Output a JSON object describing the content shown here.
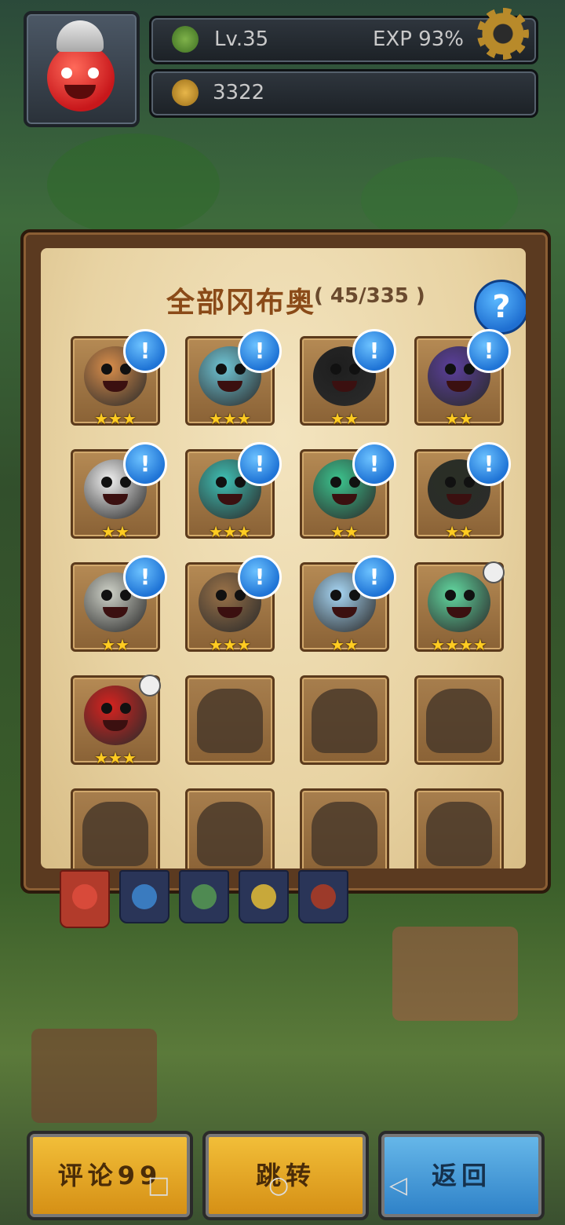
{
  "hud": {
    "level_label": "Lv.35",
    "exp_label": "EXP 93%",
    "gold_value": "3322",
    "icons": {
      "level": "clover-icon",
      "gold": "gold-pouch-icon",
      "settings": "gear-icon"
    }
  },
  "panel": {
    "title": "全部冈布奥",
    "count": "( 45/335 )",
    "help": "?",
    "badge_glyph": "!",
    "cells": [
      {
        "stars": "★★★",
        "badge": true,
        "color": "#d98e4b"
      },
      {
        "stars": "★★★",
        "badge": true,
        "color": "#70c6d6"
      },
      {
        "stars": "★★",
        "badge": true,
        "color": "#1e1e1e"
      },
      {
        "stars": "★★",
        "badge": true,
        "color": "#5b3f9c"
      },
      {
        "stars": "★★",
        "badge": true,
        "color": "#f1f1f1"
      },
      {
        "stars": "★★★",
        "badge": true,
        "color": "#3fc0b4"
      },
      {
        "stars": "★★",
        "badge": true,
        "color": "#3cc48e"
      },
      {
        "stars": "★★",
        "badge": true,
        "color": "#2a2f25"
      },
      {
        "stars": "★★",
        "badge": true,
        "color": "#cfd2c8"
      },
      {
        "stars": "★★★",
        "badge": true,
        "color": "#9a7248"
      },
      {
        "stars": "★★",
        "badge": true,
        "color": "#a8d7f5"
      },
      {
        "stars": "★★★★",
        "badge": false,
        "color": "#62d8a0"
      },
      {
        "stars": "★★★",
        "badge": false,
        "color": "#d8231f"
      }
    ]
  },
  "tabs": [
    "all-tab",
    "blue-tab",
    "green-tab",
    "yellow-tab",
    "red-tab"
  ],
  "buttons": {
    "comment": "评论99",
    "jump": "跳转",
    "back": "返回"
  },
  "nav": {
    "square": "□",
    "circle": "○",
    "back": "◁"
  }
}
